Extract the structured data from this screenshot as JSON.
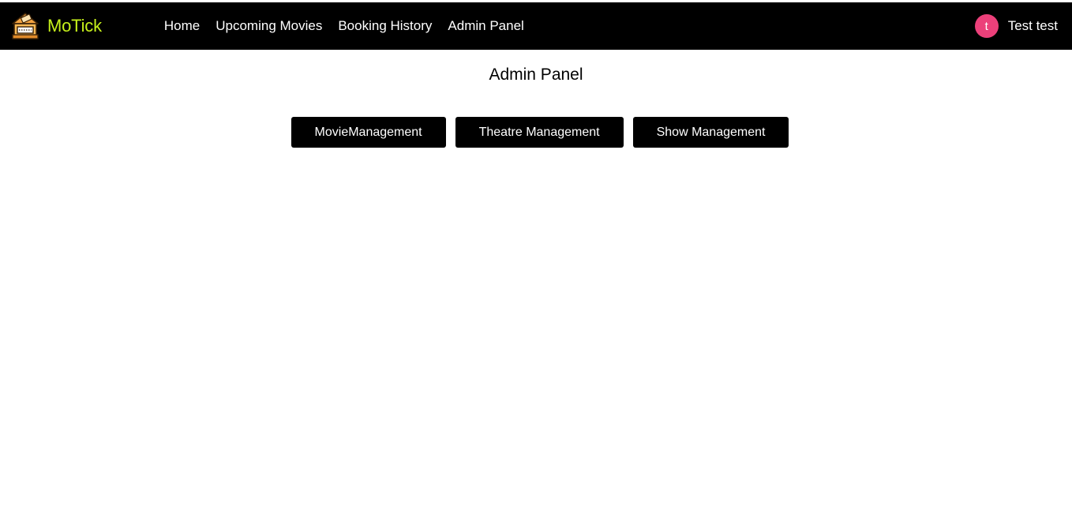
{
  "theme": {
    "navbar_bg": "#000000",
    "brand_color": "#c6f01b",
    "avatar_color": "#ec407a",
    "button_bg": "#000000"
  },
  "header": {
    "brand_name": "MoTick",
    "logo_icon": "ticket-booth-icon",
    "nav": [
      {
        "label": "Home"
      },
      {
        "label": "Upcoming Movies"
      },
      {
        "label": "Booking History"
      },
      {
        "label": "Admin Panel"
      }
    ],
    "user": {
      "avatar_letter": "t",
      "name": "Test test"
    }
  },
  "main": {
    "title": "Admin Panel",
    "buttons": [
      {
        "label": "MovieManagement"
      },
      {
        "label": "Theatre Management"
      },
      {
        "label": "Show Management"
      }
    ]
  }
}
